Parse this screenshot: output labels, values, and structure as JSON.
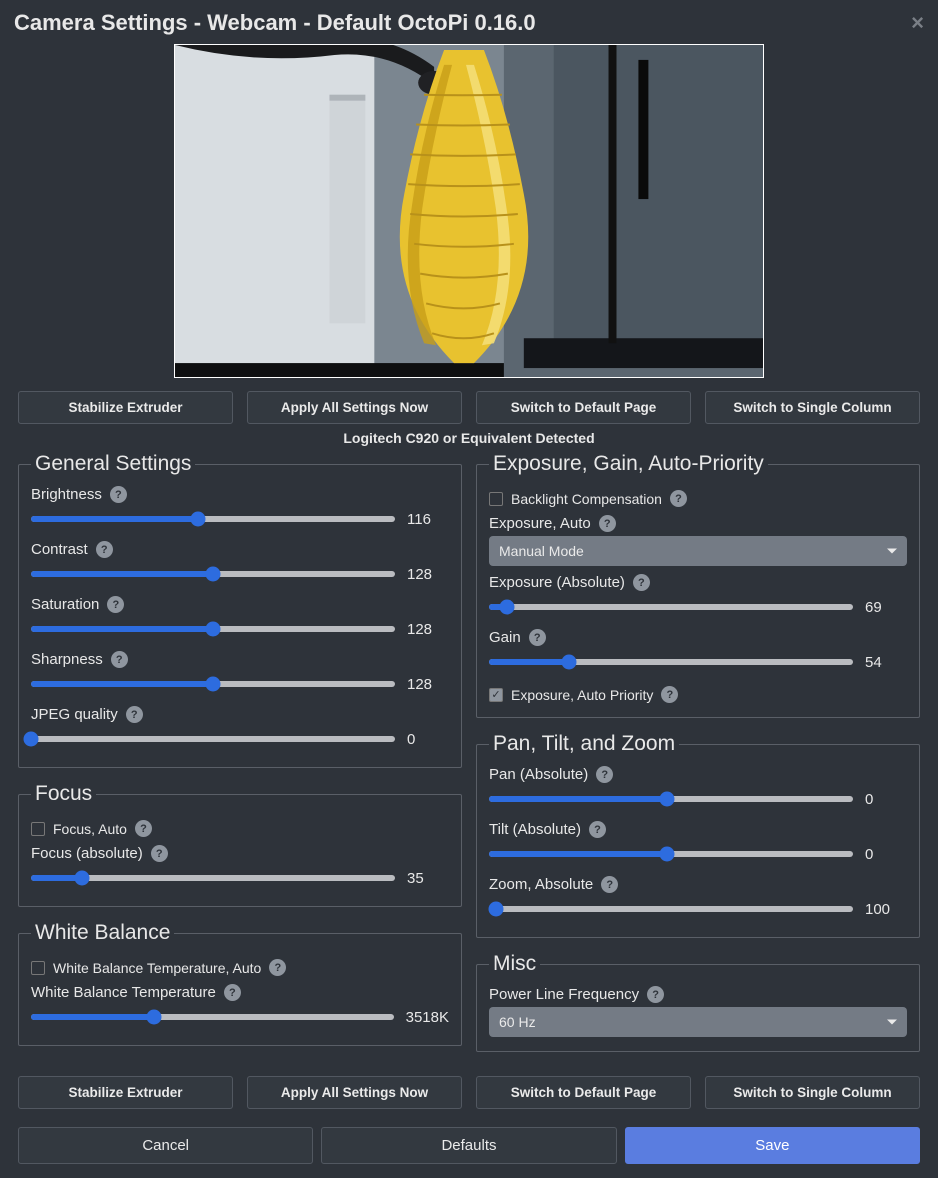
{
  "dialog": {
    "title": "Camera Settings - Webcam - Default OctoPi 0.16.0",
    "detected": "Logitech C920 or Equivalent Detected"
  },
  "buttons": {
    "stabilize": "Stabilize Extruder",
    "apply_all": "Apply All Settings Now",
    "switch_default": "Switch to Default Page",
    "switch_single": "Switch to Single Column",
    "cancel": "Cancel",
    "defaults": "Defaults",
    "save": "Save"
  },
  "general": {
    "legend": "General Settings",
    "brightness": {
      "label": "Brightness",
      "value": 116,
      "pct": 46
    },
    "contrast": {
      "label": "Contrast",
      "value": 128,
      "pct": 50
    },
    "saturation": {
      "label": "Saturation",
      "value": 128,
      "pct": 50
    },
    "sharpness": {
      "label": "Sharpness",
      "value": 128,
      "pct": 50
    },
    "jpeg": {
      "label": "JPEG quality",
      "value": 0,
      "pct": 0
    }
  },
  "focus": {
    "legend": "Focus",
    "auto": {
      "label": "Focus, Auto",
      "checked": false
    },
    "absolute": {
      "label": "Focus (absolute)",
      "value": 35,
      "pct": 14
    }
  },
  "wb": {
    "legend": "White Balance",
    "auto": {
      "label": "White Balance Temperature, Auto",
      "checked": false
    },
    "temp": {
      "label": "White Balance Temperature",
      "value": "3518K",
      "pct": 34
    }
  },
  "exposure": {
    "legend": "Exposure, Gain, Auto-Priority",
    "backlight": {
      "label": "Backlight Compensation",
      "checked": false
    },
    "auto": {
      "label": "Exposure, Auto",
      "selected": "Manual Mode"
    },
    "absolute": {
      "label": "Exposure (Absolute)",
      "value": 69,
      "pct": 5
    },
    "gain": {
      "label": "Gain",
      "value": 54,
      "pct": 22
    },
    "priority": {
      "label": "Exposure, Auto Priority",
      "checked": true
    }
  },
  "ptz": {
    "legend": "Pan, Tilt, and Zoom",
    "pan": {
      "label": "Pan (Absolute)",
      "value": 0,
      "pct": 49
    },
    "tilt": {
      "label": "Tilt (Absolute)",
      "value": 0,
      "pct": 49
    },
    "zoom": {
      "label": "Zoom, Absolute",
      "value": 100,
      "pct": 2
    }
  },
  "misc": {
    "legend": "Misc",
    "plf": {
      "label": "Power Line Frequency",
      "selected": "60 Hz"
    }
  }
}
